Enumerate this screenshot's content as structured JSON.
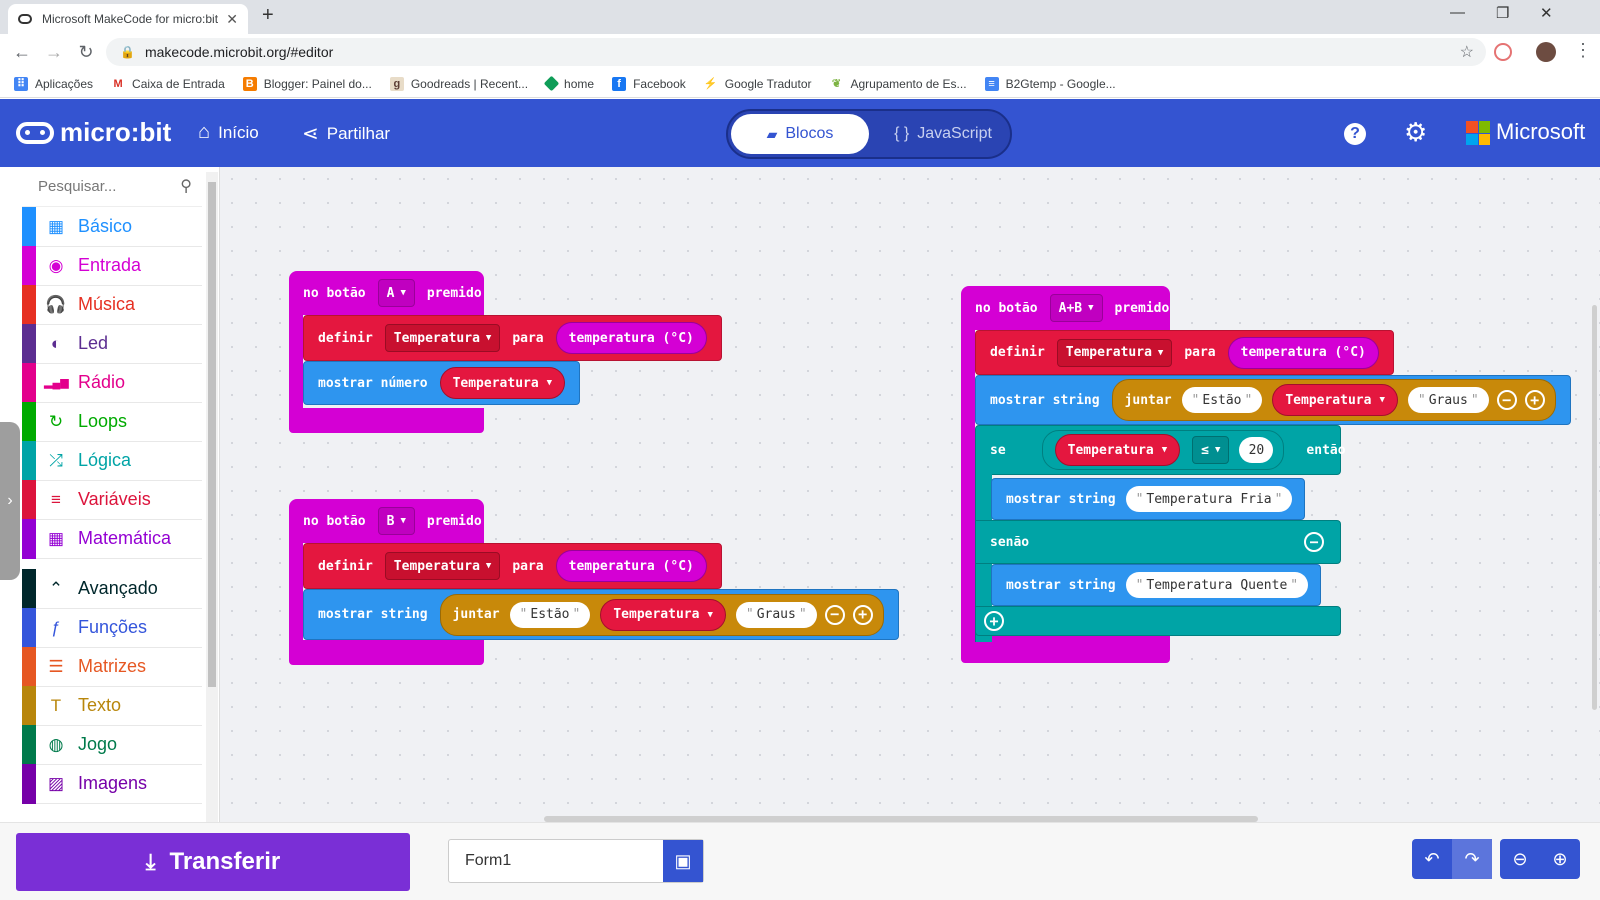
{
  "browser": {
    "tab_title": "Microsoft MakeCode for micro:bit",
    "url": "makecode.microbit.org/#editor",
    "bookmarks": [
      {
        "label": "Aplicações",
        "icon": "apps-grid-icon",
        "color": "#4285f4"
      },
      {
        "label": "Caixa de Entrada",
        "icon": "gmail-icon",
        "color": "#d93025"
      },
      {
        "label": "Blogger: Painel do...",
        "icon": "blogger-icon",
        "color": "#f57c00"
      },
      {
        "label": "Goodreads | Recent...",
        "icon": "goodreads-icon",
        "color": "#8d6e63"
      },
      {
        "label": "home",
        "icon": "home-diamond-icon",
        "color": "#0f9d58"
      },
      {
        "label": "Facebook",
        "icon": "facebook-icon",
        "color": "#1877f2"
      },
      {
        "label": "Google Tradutor",
        "icon": "bolt-icon",
        "color": "#333333"
      },
      {
        "label": "Agrupamento de Es...",
        "icon": "leaf-icon",
        "color": "#7cb342"
      },
      {
        "label": "B2Gtemp - Google...",
        "icon": "doc-icon",
        "color": "#4285f4"
      }
    ]
  },
  "header": {
    "brand": "micro:bit",
    "home_label": "Início",
    "share_label": "Partilhar",
    "blocks_label": "Blocos",
    "js_label": "JavaScript",
    "microsoft_label": "Microsoft",
    "colors": {
      "header_bg": "#3454d1"
    }
  },
  "toolbox": {
    "search_placeholder": "Pesquisar...",
    "categories": [
      {
        "label": "Básico",
        "icon": "grid-icon",
        "color": "#1e90ff"
      },
      {
        "label": "Entrada",
        "icon": "target-icon",
        "color": "#d400d4"
      },
      {
        "label": "Música",
        "icon": "headphones-icon",
        "color": "#e63022"
      },
      {
        "label": "Led",
        "icon": "toggle-icon",
        "color": "#5c2d91"
      },
      {
        "label": "Rádio",
        "icon": "signal-bars-icon",
        "color": "#e3008c"
      },
      {
        "label": "Loops",
        "icon": "refresh-icon",
        "color": "#00aa00"
      },
      {
        "label": "Lógica",
        "icon": "shuffle-icon",
        "color": "#00a4a6"
      },
      {
        "label": "Variáveis",
        "icon": "list-lines-icon",
        "color": "#dc143c"
      },
      {
        "label": "Matemática",
        "icon": "calculator-icon",
        "color": "#9400d3"
      },
      {
        "label": "Avançado",
        "icon": "chevron-up-icon",
        "color": "#00272b"
      },
      {
        "label": "Funções",
        "icon": "function-icon",
        "color": "#3455db"
      },
      {
        "label": "Matrizes",
        "icon": "numbered-list-icon",
        "color": "#e65722"
      },
      {
        "label": "Texto",
        "icon": "text-t-icon",
        "color": "#b8860b"
      },
      {
        "label": "Jogo",
        "icon": "gamepad-icon",
        "color": "#007a4b"
      },
      {
        "label": "Imagens",
        "icon": "image-icon",
        "color": "#7600a8"
      }
    ]
  },
  "blocks": {
    "on_button": "no botão",
    "pressed": "premido",
    "set": "definir",
    "to": "para",
    "show_number": "mostrar número",
    "show_string": "mostrar string",
    "join": "juntar",
    "if": "se",
    "then": "então",
    "else": "senão",
    "button_a": "A",
    "button_b": "B",
    "button_ab": "A+B",
    "variable": "Temperatura",
    "temperature_reading": "temperatura (°C)",
    "text_estao": "Estão ",
    "text_graus": " Graus",
    "operator": "≤",
    "threshold": "20",
    "text_cold": "Temperatura Fria",
    "text_hot": "Temperatura Quente"
  },
  "bottom": {
    "download_label": "Transferir",
    "project_name": "Form1"
  }
}
